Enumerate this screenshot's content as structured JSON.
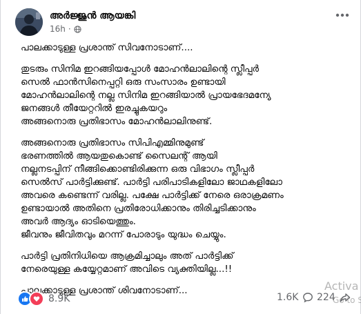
{
  "post": {
    "author": "അർജ്ജുൻ ആയങ്കി",
    "time": "16h",
    "visibility_icon": "globe-icon",
    "more_icon": "more-options-icon",
    "paragraphs": [
      [
        "പാലക്കാടുള്ള പ്രശാന്ത് സിവനോടാണ്...."
      ],
      [
        "തുടരും സിനിമ ഇറങ്ങിയപ്പോൾ മോഹൻലാലിന്റെ സ്ലീപ്പർ",
        "സെൽ ഫാൻസിനെപ്പറ്റി ഒരു സംസാരം ഉണ്ടായി",
        "മോഹൻലാലിന്റെ നല്ല സിനിമ ഇറങ്ങിയാൽ പ്രായഭേദമന്യേ",
        "ജനങ്ങൾ തീയേറ്ററിൽ ഇരച്ചുകയറും",
        "അങ്ങനൊരു പ്രതിഭാസം മോഹൻലാലിനുണ്ട്."
      ],
      [
        "അങ്ങനൊരു പ്രതിഭാസം സിപിഎമ്മിനുമുണ്ട്",
        "ഭരണത്തിൽ ആയതുകൊണ്ട് സൈലന്റ് ആയി",
        "നല്ലനടപ്പിന് നീങ്ങിക്കൊണ്ടിരിക്കുന്ന ഒരു വിഭാഗം സ്ലീപ്പർ",
        "സെൽസ് പാർട്ടിക്കുണ്ട്. പാർട്ടി പരിപാടികളിലോ ജാഥകളിലോ",
        "അവരെ കണ്ടെന്ന് വരില്ല. പക്ഷേ പാർട്ടിക്ക് നേരെ ഒരാക്രമണം",
        "ഉണ്ടായാൽ അതിനെ പ്രതിരോധിക്കാനും തിരിച്ചടിക്കാനും",
        "അവർ ആദ്യം ഓടിയെത്തും.",
        "ജീവനും ജീവിതവും മറന്ന് പോരാടും യുദ്ധം ചെയ്യും."
      ],
      [
        "പാർട്ടി പ്രതിനിധിയെ ആക്രമിച്ചാലും അത് പാർട്ടിക്ക്",
        "നേരെയുള്ള കയ്യേറ്റമാണ് അവിടെ വ്യക്തിയില്ല...!!"
      ],
      [
        "പാലക്കാടുള്ള പ്രശാന്ത് ശിവനോടാണ്..."
      ]
    ]
  },
  "footer": {
    "reaction_icons": [
      "like-icon",
      "love-icon"
    ],
    "reaction_count": "8.9K",
    "comment_count": "1.6K",
    "comment_icon": "comment-icon",
    "share_count": "224",
    "share_icon": "share-icon"
  },
  "overlay": {
    "watermark_line1": "Activa",
    "watermark_line2": "Go to Se"
  },
  "colors": {
    "like_blue": "#1877f2",
    "love_red": "#f33e58",
    "meta_gray": "#65676b"
  }
}
